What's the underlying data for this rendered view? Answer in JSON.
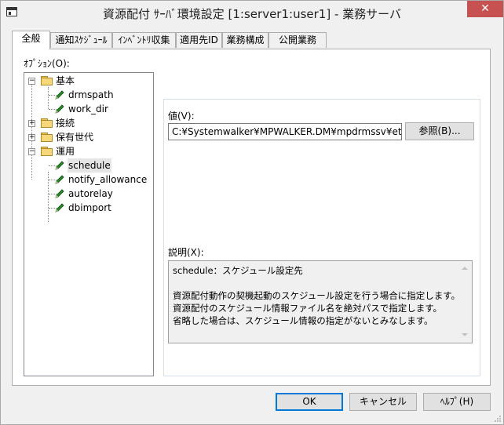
{
  "window": {
    "title": "資源配付 ｻｰﾊﾞ環境設定 [1:server1:user1] - 業務サーバ",
    "close_label": "✕"
  },
  "tabs": [
    "全般",
    "通知ｽｹｼﾞｭｰﾙ",
    "ｲﾝﾍﾞﾝﾄﾘ収集",
    "適用先ID",
    "業務構成",
    "公開業務"
  ],
  "options_label": "ｵﾌﾟｼｮﾝ(O):",
  "tree": {
    "folders": [
      "基本",
      "接続",
      "保有世代",
      "運用"
    ],
    "basic_items": [
      "drmspath",
      "work_dir"
    ],
    "operation_items": [
      "schedule",
      "notify_allowance",
      "autorelay",
      "dbimport"
    ],
    "selected": "schedule"
  },
  "value": {
    "label": "値(V):",
    "text": "C:¥Systemwalker¥MPWALKER.DM¥mpdrmssv¥etc",
    "browse_label": "参照(B)..."
  },
  "description": {
    "label": "説明(X):",
    "heading": "schedule：スケジュール設定先",
    "lines": [
      "資源配付動作の契機起動のスケジュール設定を行う場合に指定します。",
      "資源配付のスケジュール情報ファイル名を絶対パスで指定します。",
      "省略した場合は、スケジュール情報の指定がないとみなします。"
    ]
  },
  "buttons": {
    "ok": "OK",
    "cancel": "キャンセル",
    "help": "ﾍﾙﾌﾟ(H)"
  },
  "colors": {
    "window_bg": "#f0f0f0",
    "close_button": "#c75050",
    "folder": "#f6d77a",
    "pencil": "#2a8a2a",
    "default_border": "#0078d7"
  }
}
